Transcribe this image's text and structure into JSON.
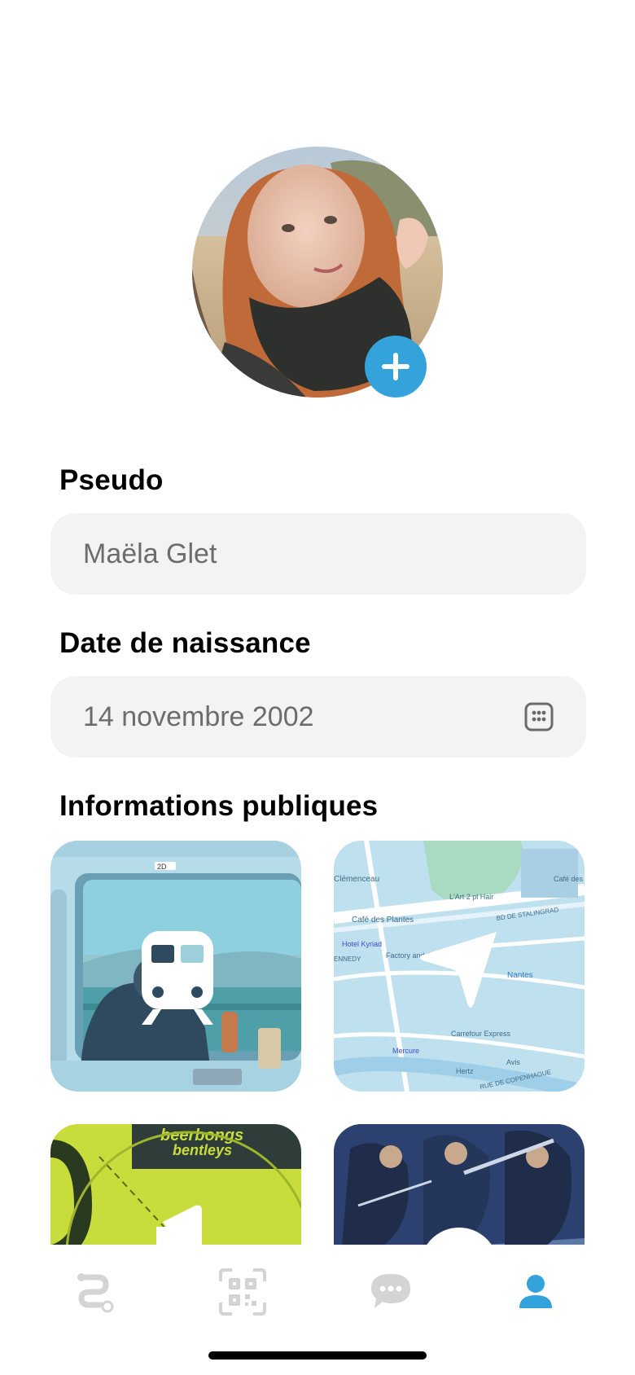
{
  "profile": {
    "add_photo_icon": "plus-icon"
  },
  "form": {
    "pseudo_label": "Pseudo",
    "pseudo_value": "Maëla Glet",
    "birthdate_label": "Date de naissance",
    "birthdate_value": "14 novembre 2002",
    "birthdate_icon": "calendar-icon"
  },
  "public_info": {
    "title": "Informations publiques",
    "tiles": [
      {
        "name": "train",
        "icon": "train-icon"
      },
      {
        "name": "location",
        "icon": "navigation-arrow-icon"
      },
      {
        "name": "music",
        "icon": "music-note-icon"
      },
      {
        "name": "play",
        "icon": "play-icon"
      }
    ],
    "map_labels": {
      "place1": "Clémenceau",
      "place2": "Café des Plantes",
      "place3": "L'Art 2 pl Hair",
      "place4": "Hotel Kyriad",
      "place5": "Factory and Co",
      "place6": "Nantes",
      "place7": "Carrefour Express",
      "place8": "Mercure",
      "place9": "Hertz",
      "place10": "Avis",
      "place11": "Café des I",
      "street1": "BD DE STALINGRAD",
      "street2": "ENNEDY",
      "street3": "RUE DE COPENHAGUE"
    },
    "album_text": {
      "line1": "beerbongs",
      "line2": "bentleys"
    },
    "train_sign": "2D"
  },
  "tabbar": {
    "tabs": [
      {
        "name": "routes",
        "icon": "route-icon",
        "active": false
      },
      {
        "name": "qr",
        "icon": "qr-code-icon",
        "active": false
      },
      {
        "name": "chat",
        "icon": "chat-bubble-icon",
        "active": false
      },
      {
        "name": "profile",
        "icon": "person-icon",
        "active": true
      }
    ]
  },
  "colors": {
    "accent": "#34a3dc",
    "inactive": "#d4d4d4",
    "field_bg": "#f3f3f2",
    "placeholder_text": "#6c6c6c"
  }
}
